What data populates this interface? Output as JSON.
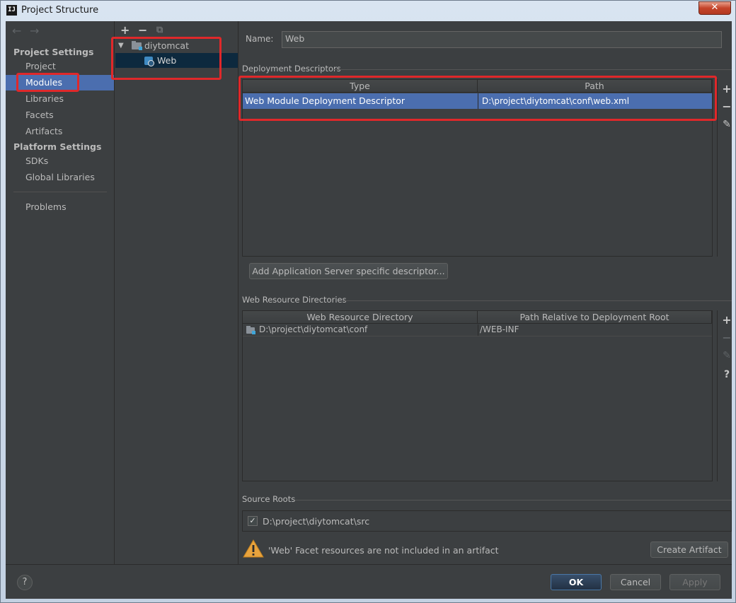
{
  "window": {
    "title": "Project Structure",
    "app_icon_text": "IJ",
    "close_glyph": "✕"
  },
  "nav": {
    "back_glyph": "←",
    "forward_glyph": "→",
    "project_settings_heading": "Project Settings",
    "project_settings_items": [
      {
        "label": "Project",
        "selected": false
      },
      {
        "label": "Modules",
        "selected": true
      },
      {
        "label": "Libraries",
        "selected": false
      },
      {
        "label": "Facets",
        "selected": false
      },
      {
        "label": "Artifacts",
        "selected": false
      }
    ],
    "platform_settings_heading": "Platform Settings",
    "platform_settings_items": [
      {
        "label": "SDKs"
      },
      {
        "label": "Global Libraries"
      }
    ],
    "problems_label": "Problems"
  },
  "tree": {
    "toolbar": {
      "add": "+",
      "remove": "−",
      "copy": "⧉"
    },
    "root": {
      "label": "diytomcat",
      "expanded": true,
      "toggle_glyph": "▼"
    },
    "child": {
      "label": "Web",
      "selected": true
    }
  },
  "main": {
    "name_label": "Name:",
    "name_value": "Web",
    "deployment_descriptors": {
      "title": "Deployment Descriptors",
      "columns": [
        "Type",
        "Path"
      ],
      "rows": [
        {
          "type": "Web Module Deployment Descriptor",
          "path": "D:\\project\\diytomcat\\conf\\web.xml",
          "selected": true
        }
      ],
      "add_server_descriptor_button": "Add Application Server specific descriptor..."
    },
    "web_resource_directories": {
      "title": "Web Resource Directories",
      "columns": [
        "Web Resource Directory",
        "Path Relative to Deployment Root"
      ],
      "rows": [
        {
          "directory": "D:\\project\\diytomcat\\conf",
          "relative_path": "/WEB-INF"
        }
      ]
    },
    "source_roots": {
      "title": "Source Roots",
      "items": [
        {
          "path": "D:\\project\\diytomcat\\src",
          "checked": true,
          "check_glyph": "✓"
        }
      ]
    },
    "warning": {
      "text": "'Web' Facet resources are not included in an artifact",
      "button": "Create Artifact"
    },
    "side_toolbar": {
      "add": "+",
      "remove": "−",
      "edit": "✎",
      "help": "?"
    }
  },
  "footer": {
    "help": "?",
    "ok": "OK",
    "cancel": "Cancel",
    "apply": "Apply"
  },
  "colors": {
    "selection": "#4b6eaf",
    "highlight_box": "#e0282a",
    "panel_bg": "#3c3f41"
  }
}
